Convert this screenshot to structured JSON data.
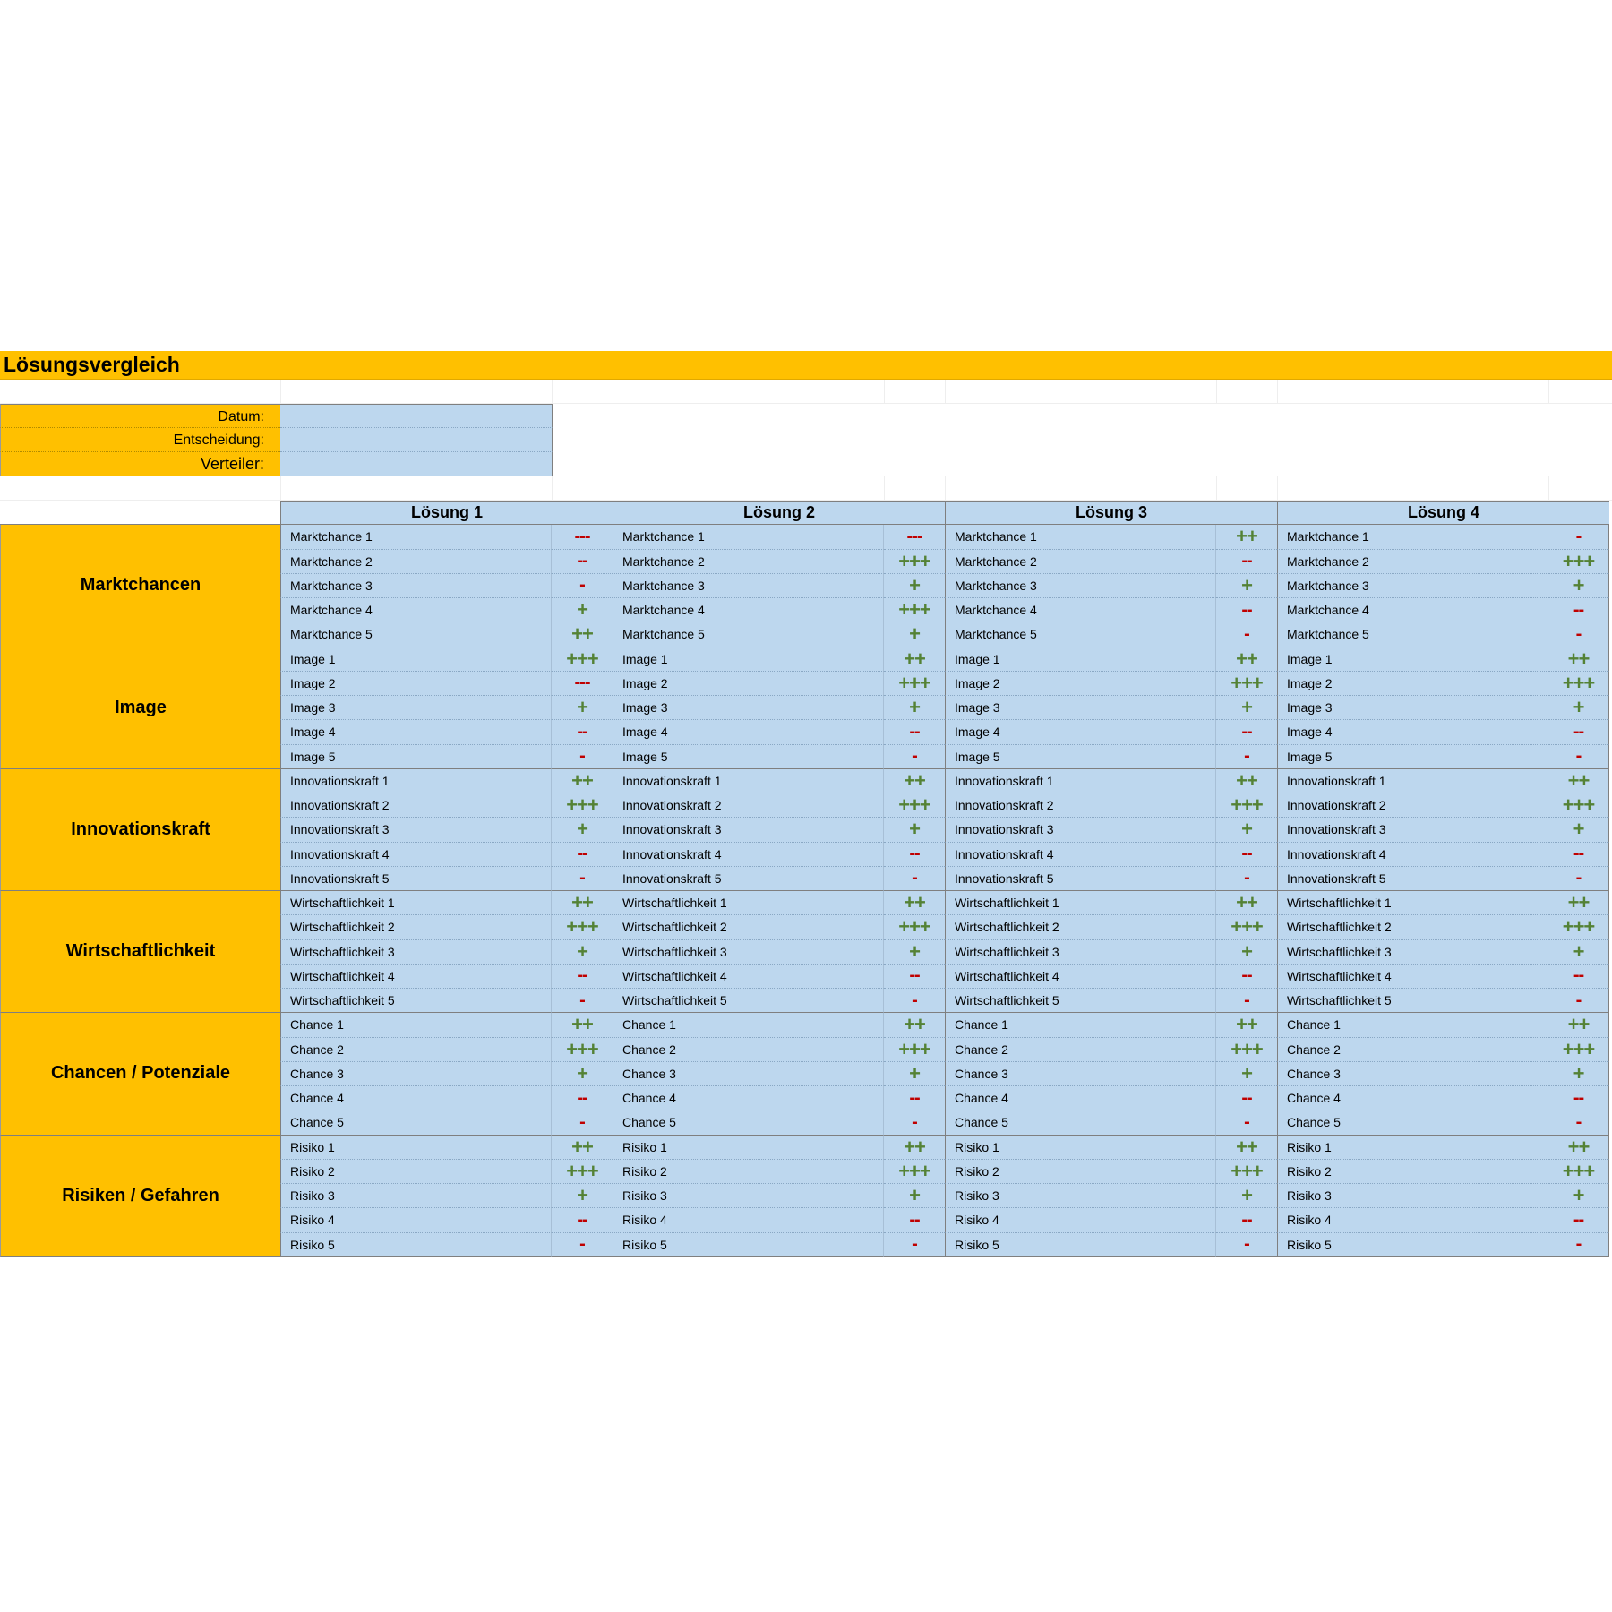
{
  "title": "Lösungsvergleich",
  "meta": {
    "date_label": "Datum:",
    "decision_label": "Entscheidung:",
    "distribution_label": "Verteiler:",
    "date_value": "",
    "decision_value": "",
    "distribution_value": ""
  },
  "solutions": [
    "Lösung 1",
    "Lösung 2",
    "Lösung 3",
    "Lösung 4"
  ],
  "colors": {
    "header_orange": "#ffc000",
    "cell_blue": "#bdd7ee",
    "positive_green": "#548235",
    "negative_red": "#c00000"
  },
  "categories": [
    {
      "name": "Marktchancen",
      "criteria": [
        "Marktchance 1",
        "Marktchance 2",
        "Marktchance 3",
        "Marktchance 4",
        "Marktchance 5"
      ],
      "scores": [
        [
          "---",
          "--",
          "-",
          "+",
          "++"
        ],
        [
          "---",
          "+++",
          "+",
          "+++",
          "+"
        ],
        [
          "++",
          "--",
          "+",
          "--",
          "-"
        ],
        [
          "-",
          "+++",
          "+",
          "--",
          "-"
        ]
      ]
    },
    {
      "name": "Image",
      "criteria": [
        "Image 1",
        "Image 2",
        "Image 3",
        "Image 4",
        "Image 5"
      ],
      "scores": [
        [
          "+++",
          "---",
          "+",
          "--",
          "-"
        ],
        [
          "++",
          "+++",
          "+",
          "--",
          "-"
        ],
        [
          "++",
          "+++",
          "+",
          "--",
          "-"
        ],
        [
          "++",
          "+++",
          "+",
          "--",
          "-"
        ]
      ]
    },
    {
      "name": "Innovationskraft",
      "criteria": [
        "Innovationskraft 1",
        "Innovationskraft 2",
        "Innovationskraft 3",
        "Innovationskraft 4",
        "Innovationskraft 5"
      ],
      "scores": [
        [
          "++",
          "+++",
          "+",
          "--",
          "-"
        ],
        [
          "++",
          "+++",
          "+",
          "--",
          "-"
        ],
        [
          "++",
          "+++",
          "+",
          "--",
          "-"
        ],
        [
          "++",
          "+++",
          "+",
          "--",
          "-"
        ]
      ]
    },
    {
      "name": "Wirtschaftlichkeit",
      "criteria": [
        "Wirtschaftlichkeit 1",
        "Wirtschaftlichkeit 2",
        "Wirtschaftlichkeit 3",
        "Wirtschaftlichkeit 4",
        "Wirtschaftlichkeit 5"
      ],
      "scores": [
        [
          "++",
          "+++",
          "+",
          "--",
          "-"
        ],
        [
          "++",
          "+++",
          "+",
          "--",
          "-"
        ],
        [
          "++",
          "+++",
          "+",
          "--",
          "-"
        ],
        [
          "++",
          "+++",
          "+",
          "--",
          "-"
        ]
      ]
    },
    {
      "name": "Chancen / Potenziale",
      "criteria": [
        "Chance 1",
        "Chance 2",
        "Chance 3",
        "Chance 4",
        "Chance 5"
      ],
      "scores": [
        [
          "++",
          "+++",
          "+",
          "--",
          "-"
        ],
        [
          "++",
          "+++",
          "+",
          "--",
          "-"
        ],
        [
          "++",
          "+++",
          "+",
          "--",
          "-"
        ],
        [
          "++",
          "+++",
          "+",
          "--",
          "-"
        ]
      ]
    },
    {
      "name": "Risiken / Gefahren",
      "criteria": [
        "Risiko 1",
        "Risiko 2",
        "Risiko 3",
        "Risiko 4",
        "Risiko 5"
      ],
      "scores": [
        [
          "++",
          "+++",
          "+",
          "--",
          "-"
        ],
        [
          "++",
          "+++",
          "+",
          "--",
          "-"
        ],
        [
          "++",
          "+++",
          "+",
          "--",
          "-"
        ],
        [
          "++",
          "+++",
          "+",
          "--",
          "-"
        ]
      ]
    }
  ]
}
